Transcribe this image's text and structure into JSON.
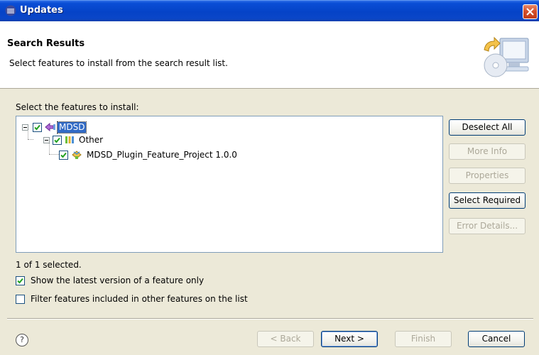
{
  "window": {
    "title": "Updates"
  },
  "header": {
    "title": "Search Results",
    "description": "Select features to install from the search result list."
  },
  "tree": {
    "label": "Select the features to install:",
    "nodes": [
      {
        "label": "MDSD",
        "checked": true,
        "selected": true,
        "icon": "category-icon"
      },
      {
        "label": "Other",
        "checked": true,
        "icon": "plugin-group-icon"
      },
      {
        "label": "MDSD_Plugin_Feature_Project 1.0.0",
        "checked": true,
        "icon": "feature-icon"
      }
    ]
  },
  "side_buttons": {
    "deselect_all": "Deselect All",
    "more_info": "More Info",
    "properties": "Properties",
    "select_required": "Select Required",
    "error_details": "Error Details..."
  },
  "status": {
    "selected_count": "1 of 1 selected."
  },
  "options": {
    "latest_only": {
      "label": "Show the latest version of a feature only",
      "checked": true
    },
    "filter_included": {
      "label": "Filter features included in other features on the list",
      "checked": false
    }
  },
  "footer": {
    "help": "?",
    "back": "< Back",
    "next": "Next >",
    "finish": "Finish",
    "cancel": "Cancel"
  }
}
